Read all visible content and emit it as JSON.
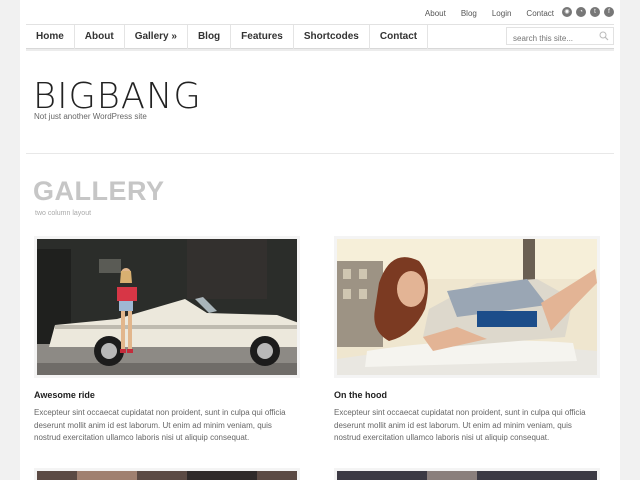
{
  "top_links": [
    "About",
    "Blog",
    "Login",
    "Contact"
  ],
  "social_icons": [
    "rss-icon",
    "feed-icon",
    "twitter-icon",
    "facebook-icon"
  ],
  "nav": [
    "Home",
    "About",
    "Gallery »",
    "Blog",
    "Features",
    "Shortcodes",
    "Contact"
  ],
  "search": {
    "placeholder": "search this site..."
  },
  "site": {
    "logo": "BIGBANG",
    "tagline": "Not just another WordPress site"
  },
  "page": {
    "title": "GALLERY",
    "subtitle": "two column layout"
  },
  "posts": [
    {
      "title": "Awesome ride",
      "excerpt": "Excepteur sint occaecat cupidatat non proident, sunt in culpa qui officia deserunt mollit anim id est laborum. Ut enim ad minim veniam, quis nostrud exercitation ullamco laboris nisi ut aliquip consequat."
    },
    {
      "title": "On the hood",
      "excerpt": "Excepteur sint occaecat cupidatat non proident, sunt in culpa qui officia deserunt mollit anim id est laborum. Ut enim ad minim veniam, quis nostrud exercitation ullamco laboris nisi ut aliquip consequat."
    }
  ],
  "colors": {
    "accent_gray": "#c6c6c6",
    "text": "#333333"
  }
}
